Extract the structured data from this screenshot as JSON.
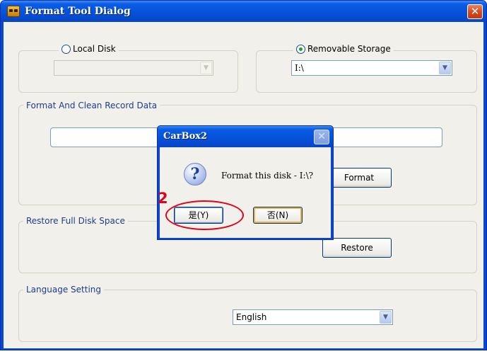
{
  "window": {
    "title": "Format Tool Dialog",
    "icon": "app-icon",
    "close_glyph": "✕"
  },
  "source": {
    "local_disk_label": "Local Disk",
    "local_disk_selected": false,
    "local_disk_value": "",
    "removable_label": "Removable Storage",
    "removable_selected": true,
    "removable_value": "I:\\"
  },
  "format_group": {
    "legend": "Format And Clean Record Data",
    "format_button": "Format"
  },
  "restore_group": {
    "legend": "Restore Full Disk Space",
    "restore_button": "Restore"
  },
  "language_group": {
    "legend": "Language Setting",
    "selected": "English"
  },
  "message_box": {
    "title": "CarBox2",
    "close_glyph": "✕",
    "icon": "question-icon",
    "icon_glyph": "?",
    "text": "Format this disk - I:\\?",
    "yes_button": "是(Y)",
    "no_button": "否(N)"
  },
  "annotation": {
    "step_number": "2",
    "color": "#e3001b"
  },
  "colors": {
    "titlebar": "#0551d8",
    "client": "#f1f0ea",
    "legend_text": "#1d3c8c"
  }
}
